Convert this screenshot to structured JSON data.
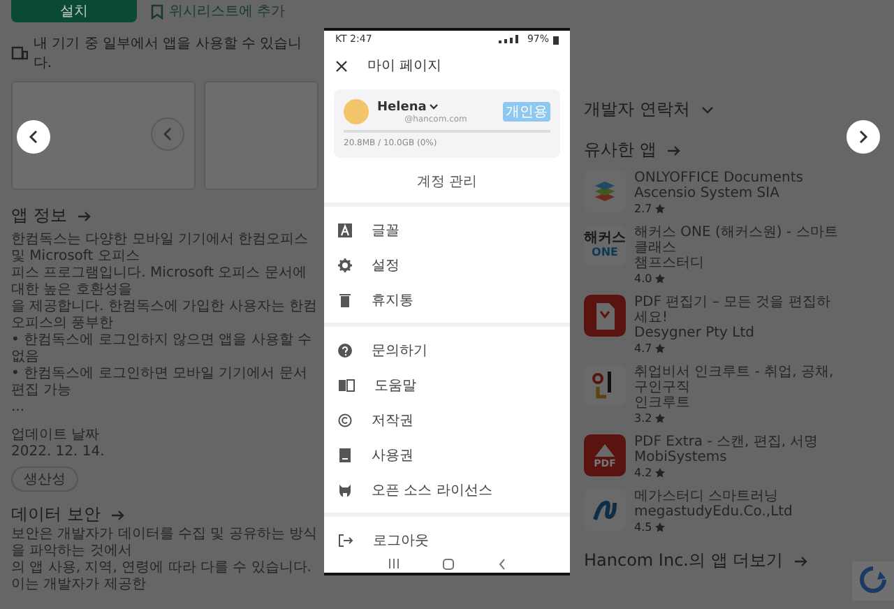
{
  "store_page": {
    "install_button": "설치",
    "wishlist_button": "위시리스트에 추가",
    "device_note": "내 기기 중 일부에서 앱을 사용할 수 있습니다.",
    "about": {
      "title": "앱 정보",
      "lines": [
        "한컴독스는 다양한 모바일 기기에서 한컴오피스 및 Microsoft 오피스",
        "피스 프로그램입니다. Microsoft 오피스 문서에 대한 높은 호환성을",
        "을 제공합니다. 한컴독스에 가입한 사용자는 한컴오피스의 풍부한",
        "• 한컴독스에 로그인하지 않으면 앱을 사용할 수 없음",
        "• 한컴독스에 로그인하면 모바일 기기에서 문서 편집 가능",
        "..."
      ]
    },
    "updated_label": "업데이트 날짜",
    "updated_date": "2022. 12. 14.",
    "category_chip": "생산성",
    "data_safety": {
      "title": "데이터 보안",
      "lines": [
        "보안은 개발자가 데이터를 수집 및 공유하는 방식을 파악하는 것에서",
        "의 앱 사용, 지역, 연령에 따라 다를 수 있습니다. 이는 개발자가 제공한"
      ]
    },
    "developer_contact": "개발자 연락처",
    "similar_apps": {
      "title": "유사한 앱",
      "apps": [
        {
          "kind": "layers",
          "name": "ONLYOFFICE Documents",
          "developer": "Ascensio System SIA",
          "rating": "2.7"
        },
        {
          "kind": "wordmark",
          "icon_text": [
            "해커스",
            "ONE"
          ],
          "name": "해커스 ONE (해커스원) - 스마트 클래스",
          "developer": "챔프스터디",
          "rating": "4.0"
        },
        {
          "kind": "document",
          "name": "PDF 편집기 – 모든 것을 편집하세요!",
          "developer": "Desygner Pty Ltd",
          "rating": "4.7"
        },
        {
          "kind": "shapes",
          "name": "취업비서 인크루트 - 취업, 공채, 구인구직",
          "developer": "인크루트",
          "rating": "3.2"
        },
        {
          "kind": "triangle",
          "icon_text": [
            "PDF"
          ],
          "name": "PDF Extra - 스캔, 편집, 서명",
          "developer": "MobiSystems",
          "rating": "4.2"
        },
        {
          "kind": "swirl",
          "name": "메가스터디 스마트러닝",
          "developer": "megastudyEdu.Co.,Ltd",
          "rating": "4.5"
        }
      ]
    },
    "more_from": "Hancom Inc.의 앱 더보기"
  },
  "screenshot_viewer": {
    "status_bar": {
      "carrier_time": "KT 2:47",
      "battery": "97%"
    },
    "title": "마이 페이지",
    "account": {
      "name": "Helena",
      "email": "@hancom.com",
      "plan": "개인용",
      "storage": "20.8MB / 10.0GB (0%)",
      "level": 0
    },
    "manage_account": "계정 관리",
    "menu_groups": [
      [
        {
          "kind": "font",
          "label": "글꼴"
        },
        {
          "kind": "gear",
          "label": "설정"
        },
        {
          "kind": "trash",
          "label": "휴지통"
        }
      ],
      [
        {
          "kind": "question",
          "label": "문의하기"
        },
        {
          "kind": "book-open",
          "label": "도움말"
        },
        {
          "kind": "copyright",
          "label": "저작권"
        },
        {
          "kind": "notebook",
          "label": "사용권"
        },
        {
          "kind": "cat",
          "label": "오픈 소스 라이선스"
        }
      ],
      [
        {
          "kind": "exit",
          "label": "로그아웃"
        }
      ]
    ]
  }
}
